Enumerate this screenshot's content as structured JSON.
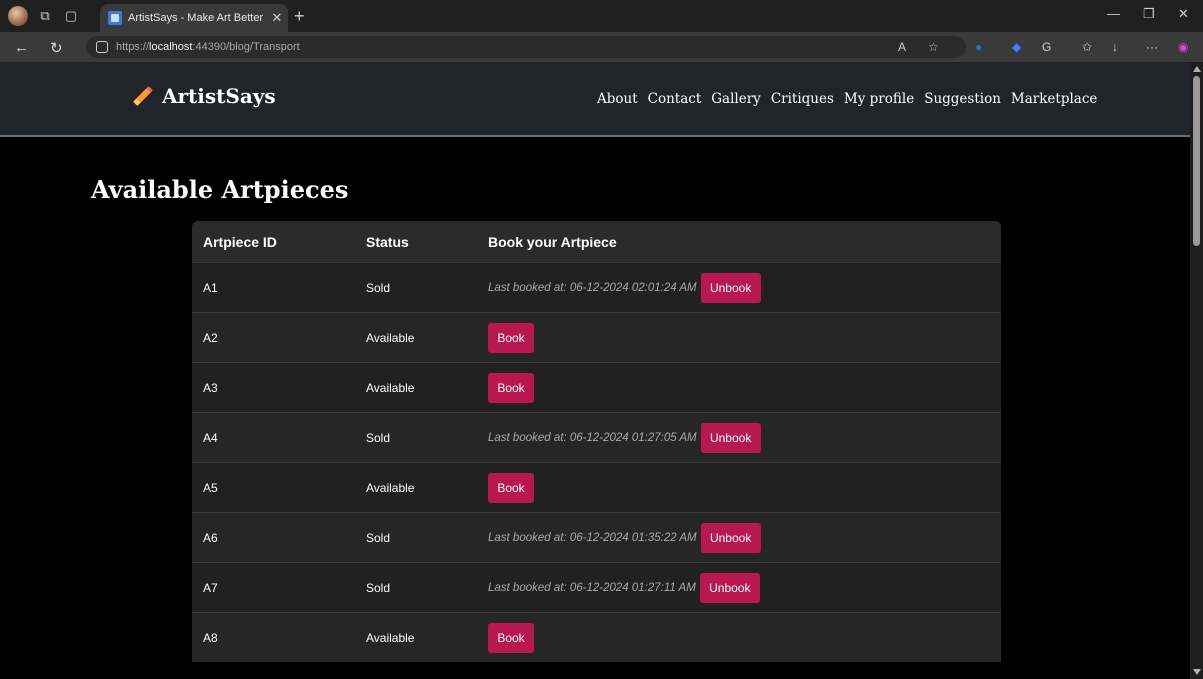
{
  "browser": {
    "tab_title": "ArtistSays - Make Art Better",
    "url_prefix": "https://",
    "url_host": "localhost",
    "url_rest": ":44390/blog/Transport"
  },
  "site": {
    "brand": "ArtistSays",
    "nav": [
      "About",
      "Contact",
      "Gallery",
      "Critiques",
      "My profile",
      "Suggestion",
      "Marketplace"
    ]
  },
  "page": {
    "title": "Available Artpieces",
    "columns": [
      "Artpiece ID",
      "Status",
      "Book your Artpiece"
    ],
    "rows": [
      {
        "id": "A1",
        "status": "Sold",
        "booked": "Last booked at: 06-12-2024 02:01:24 AM",
        "action": "Unbook"
      },
      {
        "id": "A2",
        "status": "Available",
        "booked": "",
        "action": "Book"
      },
      {
        "id": "A3",
        "status": "Available",
        "booked": "",
        "action": "Book"
      },
      {
        "id": "A4",
        "status": "Sold",
        "booked": "Last booked at: 06-12-2024 01:27:05 AM",
        "action": "Unbook"
      },
      {
        "id": "A5",
        "status": "Available",
        "booked": "",
        "action": "Book"
      },
      {
        "id": "A6",
        "status": "Sold",
        "booked": "Last booked at: 06-12-2024 01:35:22 AM",
        "action": "Unbook"
      },
      {
        "id": "A7",
        "status": "Sold",
        "booked": "Last booked at: 06-12-2024 01:27:11 AM",
        "action": "Unbook"
      },
      {
        "id": "A8",
        "status": "Available",
        "booked": "",
        "action": "Book"
      }
    ]
  },
  "colors": {
    "accent": "#b8174f",
    "header_bg": "#212529",
    "table_bg": "#212121"
  },
  "icons": {
    "back": "back-arrow-icon",
    "refresh": "refresh-icon",
    "lock": "lock-icon",
    "brand": "pencil-icon"
  }
}
